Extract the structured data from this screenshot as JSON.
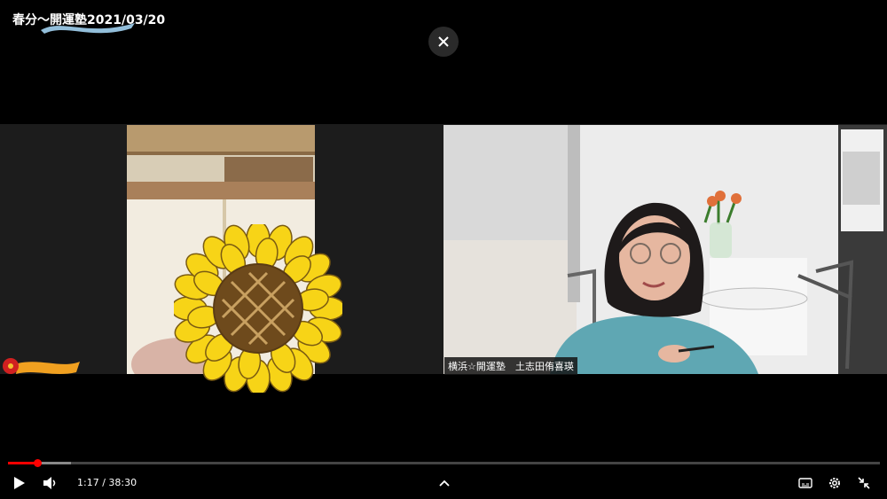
{
  "video": {
    "title": "春分〜開運塾2021/03/20"
  },
  "participants": [
    {
      "name": ""
    },
    {
      "name": "横浜☆開運塾　土志田侑喜瑛"
    }
  ],
  "player": {
    "current_time": "1:17",
    "separator": " / ",
    "duration": "38:30",
    "progress_fraction": 0.034,
    "buffer_fraction": 0.072
  },
  "colors": {
    "progress": "#ff0000",
    "background": "#000000"
  }
}
